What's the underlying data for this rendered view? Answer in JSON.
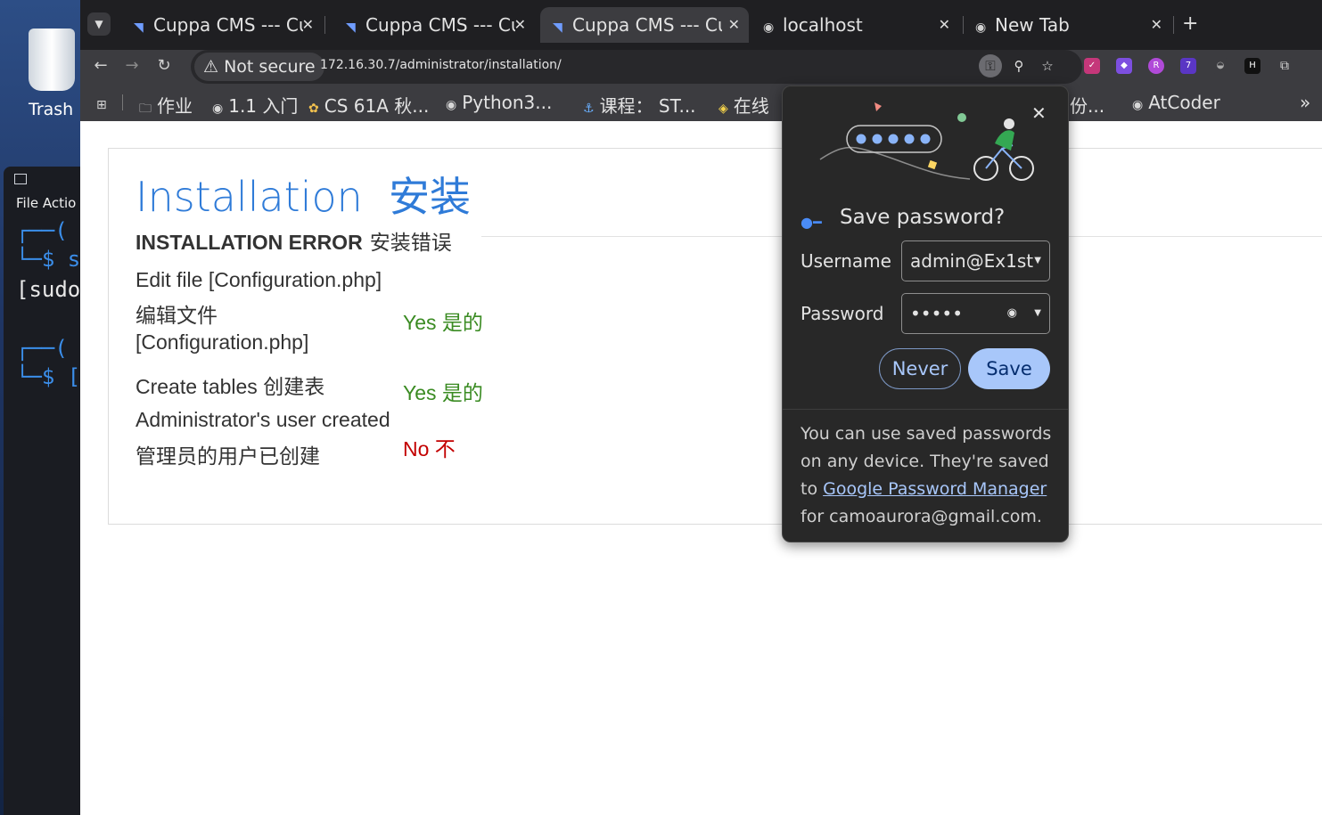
{
  "desktop": {
    "trash_label": "Trash",
    "terminal": {
      "menu": "File  Actio",
      "lines": [
        "┌──(",
        "└─$ s",
        "[sudo",
        "┌──(",
        "└─$ ["
      ]
    }
  },
  "browser": {
    "tabs": [
      {
        "title": "Cuppa CMS --- Cu",
        "active": false
      },
      {
        "title": "Cuppa CMS --- Cu",
        "active": false
      },
      {
        "title": "Cuppa CMS --- Cu",
        "active": true
      },
      {
        "title": "localhost",
        "active": false
      },
      {
        "title": "New Tab",
        "active": false
      }
    ],
    "not_secure_label": "Not secure",
    "url": "172.16.30.7/administrator/installation/",
    "extension_badge": "7",
    "bookmarks": [
      "作业",
      "1.1 入门",
      "CS 61A 秋...",
      "Python3...",
      "课程： ST...",
      "在线",
      "份...",
      "AtCoder"
    ],
    "more_bookmarks": "»"
  },
  "page": {
    "title_en": "Installation",
    "title_cn": "安装",
    "error_en": "INSTALLATION ERROR",
    "error_cn": "安装错误",
    "rows": [
      {
        "label": "Edit file [Configuration.php]",
        "value": ""
      },
      {
        "label": "编辑文件",
        "label2": "[Configuration.php]",
        "value": "Yes  是的",
        "status": "ok"
      },
      {
        "label": "Create tables  创建表",
        "value": "Yes  是的",
        "status": "ok"
      },
      {
        "label": "Administrator's user created",
        "label2": "管理员的用户已创建",
        "value": "No  不",
        "status": "bad"
      }
    ],
    "colors": {
      "title": "#2f7bd8",
      "ok": "#3a8b22",
      "bad": "#c30000"
    }
  },
  "password_dialog": {
    "title": "Save password?",
    "username_label": "Username",
    "username_value": "admin@Ex1st",
    "password_label": "Password",
    "password_value": "•••••",
    "never_label": "Never",
    "save_label": "Save",
    "footer_pre": "You can use saved passwords on any device. They're saved to ",
    "footer_link": "Google Password Manager",
    "footer_post": " for camoaurora@gmail.com.",
    "colors": {
      "accent": "#a8c7fa",
      "bg": "#282828"
    }
  }
}
